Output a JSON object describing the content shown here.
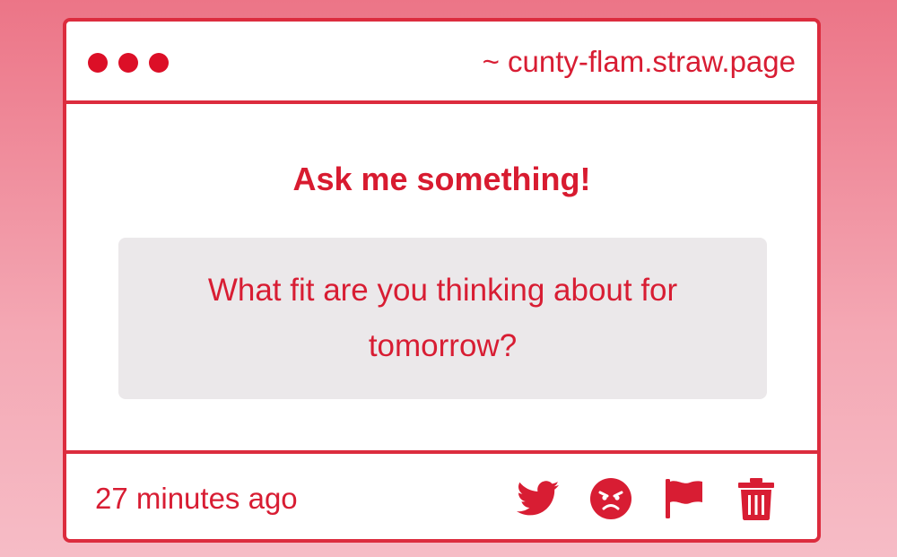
{
  "window": {
    "url": "~ cunty-flam.straw.page"
  },
  "main": {
    "heading": "Ask me something!",
    "question": "What fit are you thinking about for tomorrow?"
  },
  "footer": {
    "timestamp": "27 minutes ago",
    "actions": [
      {
        "icon": "twitter-icon"
      },
      {
        "icon": "angry-face-icon"
      },
      {
        "icon": "flag-icon"
      },
      {
        "icon": "trash-icon"
      }
    ]
  },
  "colors": {
    "accent": "#dc2c3e",
    "text": "#d81d33",
    "question_bg": "#ebe8ea",
    "background_top": "#ec7587",
    "background_bottom": "#f6bcc6"
  }
}
